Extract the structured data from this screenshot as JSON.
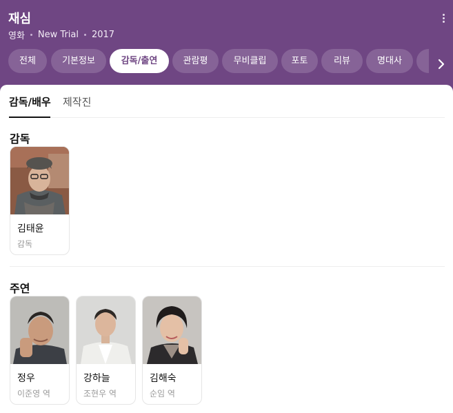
{
  "header": {
    "title": "재심",
    "genre": "영화",
    "english_title": "New Trial",
    "year": "2017",
    "colors": {
      "background": "#6f4683",
      "active_tab_text": "#6f4683"
    }
  },
  "tabs": [
    {
      "label": "전체",
      "active": false
    },
    {
      "label": "기본정보",
      "active": false
    },
    {
      "label": "감독/출연",
      "active": true
    },
    {
      "label": "관람평",
      "active": false
    },
    {
      "label": "무비클립",
      "active": false
    },
    {
      "label": "포토",
      "active": false
    },
    {
      "label": "리뷰",
      "active": false
    },
    {
      "label": "명대사",
      "active": false
    }
  ],
  "subtabs": [
    {
      "label": "감독/배우",
      "active": true
    },
    {
      "label": "제작진",
      "active": false
    }
  ],
  "sections": {
    "director": {
      "title": "감독",
      "people": [
        {
          "name": "김태윤",
          "role": "감독"
        }
      ]
    },
    "cast": {
      "title": "주연",
      "people": [
        {
          "name": "정우",
          "role": "이준영 역"
        },
        {
          "name": "강하늘",
          "role": "조현우 역"
        },
        {
          "name": "김해숙",
          "role": "순임 역"
        }
      ]
    }
  }
}
